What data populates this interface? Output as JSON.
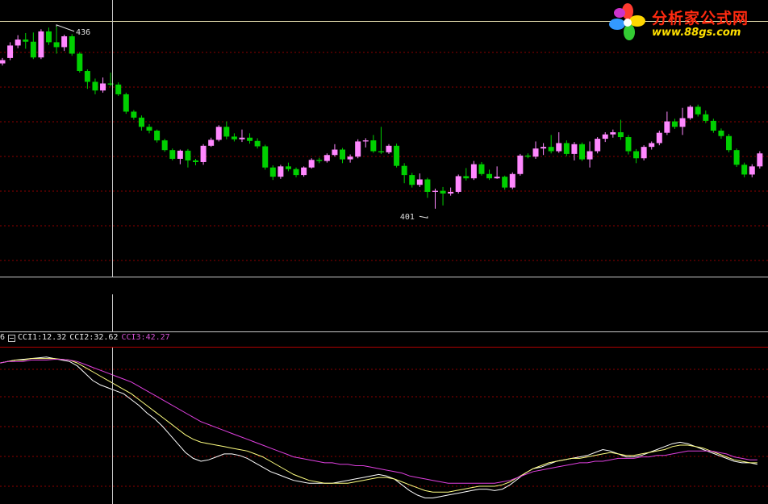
{
  "watermark": {
    "title": "分析家公式网",
    "url": "www.88gs.com",
    "colors": {
      "title": "#ff2a10",
      "url": "#ffe000"
    }
  },
  "indicator_legend": {
    "prefix": "6",
    "items": [
      {
        "text": "CCI1:12.32",
        "color": "#e8e8e8"
      },
      {
        "text": "CCI2:32.62",
        "color": "#e8e8e8"
      },
      {
        "text": "CCI3:42.27",
        "color": "#d050d0"
      }
    ]
  },
  "colors": {
    "up": "#ff88ff",
    "down": "#00d000",
    "grid": "#8b0000",
    "border": "#c8c8c8",
    "crosshair": "#c8c8c8"
  },
  "chart_data": [
    {
      "type": "candlestick",
      "ylim": [
        393,
        440
      ],
      "annotations": [
        {
          "text": "436",
          "value": 436,
          "index": 7
        },
        {
          "text": "401",
          "value": 401,
          "index": 55
        }
      ],
      "ohlc": [
        [
          429.2,
          429.8,
          430.2,
          428.8
        ],
        [
          430.2,
          432.5,
          433.1,
          429.8
        ],
        [
          432.5,
          433.6,
          434.4,
          432.0
        ],
        [
          433.6,
          433.2,
          434.8,
          431.9
        ],
        [
          433.2,
          430.3,
          434.9,
          430.0
        ],
        [
          430.3,
          435.1,
          435.5,
          430.0
        ],
        [
          435.1,
          433.1,
          435.8,
          432.6
        ],
        [
          433.1,
          432.2,
          436.0,
          431.0
        ],
        [
          432.2,
          434.2,
          434.5,
          431.5
        ],
        [
          434.2,
          431.0,
          434.6,
          430.6
        ],
        [
          431.0,
          427.8,
          431.3,
          427.5
        ],
        [
          427.8,
          425.8,
          428.1,
          424.5
        ],
        [
          425.8,
          424.2,
          426.4,
          423.5
        ],
        [
          424.2,
          425.5,
          426.6,
          423.8
        ],
        [
          425.5,
          425.3,
          427.5,
          425.0
        ],
        [
          425.3,
          423.5,
          425.7,
          423.2
        ],
        [
          423.5,
          420.3,
          423.8,
          419.9
        ],
        [
          420.3,
          419.2,
          420.6,
          418.8
        ],
        [
          419.2,
          417.5,
          419.6,
          416.8
        ],
        [
          417.5,
          416.8,
          418.0,
          416.3
        ],
        [
          416.8,
          415.0,
          417.0,
          414.6
        ],
        [
          415.0,
          413.2,
          415.3,
          412.9
        ],
        [
          413.2,
          411.6,
          413.5,
          411.3
        ],
        [
          411.6,
          413.1,
          413.3,
          410.6
        ],
        [
          413.1,
          411.3,
          413.4,
          410.0
        ],
        [
          411.3,
          411.0,
          411.6,
          410.4
        ],
        [
          411.0,
          414.0,
          414.3,
          410.5
        ],
        [
          414.0,
          415.1,
          415.5,
          413.8
        ],
        [
          415.1,
          417.5,
          417.8,
          414.8
        ],
        [
          417.5,
          415.7,
          418.5,
          415.2
        ],
        [
          415.7,
          415.2,
          416.3,
          414.8
        ],
        [
          415.2,
          415.5,
          417.0,
          414.7
        ],
        [
          415.5,
          414.9,
          416.3,
          414.4
        ],
        [
          414.9,
          413.9,
          415.4,
          413.5
        ],
        [
          413.9,
          410.0,
          414.2,
          409.6
        ],
        [
          410.0,
          408.3,
          410.4,
          407.7
        ],
        [
          408.3,
          410.2,
          410.5,
          407.9
        ],
        [
          410.2,
          409.7,
          410.9,
          409.3
        ],
        [
          409.7,
          408.6,
          410.0,
          408.2
        ],
        [
          408.6,
          410.0,
          410.2,
          408.3
        ],
        [
          410.0,
          411.4,
          411.7,
          409.8
        ],
        [
          411.4,
          411.2,
          411.8,
          410.8
        ],
        [
          411.2,
          412.3,
          412.6,
          410.9
        ],
        [
          412.3,
          413.3,
          414.3,
          412.0
        ],
        [
          413.3,
          411.5,
          413.6,
          410.8
        ],
        [
          411.5,
          412.0,
          412.4,
          410.9
        ],
        [
          412.0,
          414.8,
          415.2,
          411.7
        ],
        [
          414.8,
          415.0,
          415.4,
          413.7
        ],
        [
          415.0,
          413.0,
          416.0,
          412.7
        ],
        [
          413.0,
          412.8,
          417.5,
          412.5
        ],
        [
          412.8,
          414.0,
          414.3,
          412.5
        ],
        [
          414.0,
          410.3,
          414.4,
          410.0
        ],
        [
          410.3,
          408.6,
          410.8,
          407.1
        ],
        [
          408.6,
          406.8,
          409.0,
          406.3
        ],
        [
          406.8,
          407.8,
          408.9,
          406.4
        ],
        [
          407.8,
          405.5,
          408.1,
          404.4
        ],
        [
          405.5,
          405.7,
          406.1,
          402.4
        ],
        [
          405.7,
          405.2,
          406.4,
          403.0
        ],
        [
          405.2,
          405.5,
          406.3,
          404.8
        ],
        [
          405.5,
          408.4,
          408.7,
          405.2
        ],
        [
          408.4,
          408.0,
          409.9,
          407.6
        ],
        [
          408.0,
          410.6,
          411.2,
          407.7
        ],
        [
          410.6,
          408.8,
          411.0,
          408.5
        ],
        [
          408.8,
          408.0,
          409.6,
          407.7
        ],
        [
          408.0,
          408.3,
          410.2,
          407.9
        ],
        [
          408.3,
          406.3,
          408.5,
          405.9
        ],
        [
          406.3,
          408.8,
          409.1,
          406.0
        ],
        [
          408.8,
          412.2,
          412.5,
          408.5
        ],
        [
          412.2,
          412.0,
          412.6,
          411.7
        ],
        [
          412.0,
          413.5,
          414.8,
          411.6
        ],
        [
          413.5,
          413.8,
          414.5,
          412.3
        ],
        [
          413.8,
          413.0,
          416.0,
          412.6
        ],
        [
          413.0,
          414.5,
          416.5,
          412.7
        ],
        [
          414.5,
          412.5,
          415.0,
          412.1
        ],
        [
          412.5,
          414.3,
          414.7,
          411.3
        ],
        [
          414.3,
          411.5,
          414.6,
          411.2
        ],
        [
          411.5,
          413.0,
          414.8,
          410.0
        ],
        [
          413.0,
          415.3,
          415.6,
          412.6
        ],
        [
          415.3,
          416.1,
          416.5,
          414.7
        ],
        [
          416.1,
          416.5,
          417.0,
          415.5
        ],
        [
          416.5,
          415.6,
          418.8,
          415.1
        ],
        [
          415.6,
          413.0,
          416.0,
          412.4
        ],
        [
          413.0,
          411.7,
          413.4,
          410.8
        ],
        [
          411.7,
          413.8,
          414.1,
          411.3
        ],
        [
          413.8,
          414.5,
          414.8,
          413.3
        ],
        [
          414.5,
          416.4,
          416.8,
          414.1
        ],
        [
          416.4,
          418.5,
          420.3,
          416.0
        ],
        [
          418.5,
          417.5,
          419.0,
          417.1
        ],
        [
          417.5,
          419.1,
          421.0,
          416.0
        ],
        [
          419.1,
          421.2,
          421.5,
          418.8
        ],
        [
          421.2,
          419.8,
          421.6,
          419.4
        ],
        [
          419.8,
          418.6,
          420.5,
          418.2
        ],
        [
          418.6,
          416.8,
          419.0,
          416.4
        ],
        [
          416.8,
          415.8,
          417.2,
          415.3
        ],
        [
          415.8,
          413.2,
          416.2,
          412.8
        ],
        [
          413.2,
          410.5,
          413.5,
          410.1
        ],
        [
          410.5,
          408.7,
          410.9,
          408.2
        ],
        [
          408.7,
          410.2,
          410.6,
          408.2
        ],
        [
          410.2,
          412.6,
          413.0,
          409.8
        ]
      ]
    },
    {
      "type": "line",
      "ylim": [
        0,
        100
      ],
      "series": [
        {
          "name": "CCI1",
          "color": "#ffffff",
          "values": [
            95,
            96,
            97,
            97.5,
            98,
            98.5,
            99,
            98,
            97,
            96,
            93,
            88,
            83,
            80,
            78,
            76,
            74,
            70,
            66,
            61,
            57,
            52,
            46,
            40,
            34,
            30,
            28,
            29,
            31,
            33,
            33,
            32,
            30,
            27,
            24,
            21,
            19,
            17,
            15,
            14,
            13,
            13,
            13,
            13,
            14,
            15,
            16,
            17,
            18,
            19,
            18,
            16,
            12,
            8,
            5,
            3,
            3,
            4,
            5,
            6,
            7,
            8,
            9,
            9,
            8,
            9,
            12,
            16,
            20,
            23,
            24,
            26,
            28,
            29,
            30,
            31,
            32,
            34,
            36,
            35,
            33,
            31,
            31,
            32,
            34,
            36,
            38,
            40,
            41,
            40,
            38,
            36,
            34,
            32,
            30,
            28,
            27,
            27,
            26
          ]
        },
        {
          "name": "CCI2",
          "color": "#ffff80",
          "values": [
            95,
            96,
            97,
            97,
            98,
            98,
            98,
            98,
            97.5,
            97,
            95,
            92,
            89,
            86,
            83,
            80,
            77,
            74,
            70,
            66,
            62,
            58,
            54,
            50,
            46,
            43,
            41,
            40,
            39,
            38,
            37,
            36,
            35,
            33,
            31,
            28,
            25,
            22,
            19,
            17,
            15,
            14,
            13,
            13,
            13,
            13,
            14,
            15,
            16,
            17,
            17,
            16,
            14,
            12,
            10,
            8,
            7,
            7,
            7,
            8,
            9,
            10,
            11,
            11,
            11,
            12,
            14,
            17,
            20,
            23,
            25,
            27,
            28,
            29,
            30,
            30,
            31,
            32,
            33,
            34,
            33,
            32,
            32,
            33,
            34,
            35,
            36,
            38,
            39,
            39,
            38,
            37,
            35,
            33,
            31,
            29,
            28,
            27,
            27
          ]
        },
        {
          "name": "CCI3",
          "color": "#e040e0",
          "values": [
            95,
            96,
            96,
            96,
            97,
            97,
            97,
            97.5,
            97.5,
            97,
            96,
            94,
            92,
            90,
            88,
            86,
            84,
            82,
            79,
            76,
            73,
            70,
            67,
            64,
            61,
            58,
            55,
            53,
            51,
            49,
            47,
            45,
            43,
            41,
            39,
            37,
            35,
            33,
            31,
            30,
            29,
            28,
            27,
            27,
            26,
            26,
            25,
            25,
            24,
            23,
            22,
            21,
            20,
            18,
            17,
            16,
            15,
            14,
            13,
            13,
            13,
            13,
            13,
            13,
            13,
            14,
            15,
            17,
            19,
            21,
            22,
            23,
            24,
            25,
            26,
            27,
            27,
            28,
            28,
            29,
            30,
            30,
            30,
            31,
            31,
            32,
            32,
            33,
            34,
            35,
            35,
            35,
            35,
            34,
            33,
            31,
            30,
            29,
            29
          ]
        }
      ]
    }
  ]
}
